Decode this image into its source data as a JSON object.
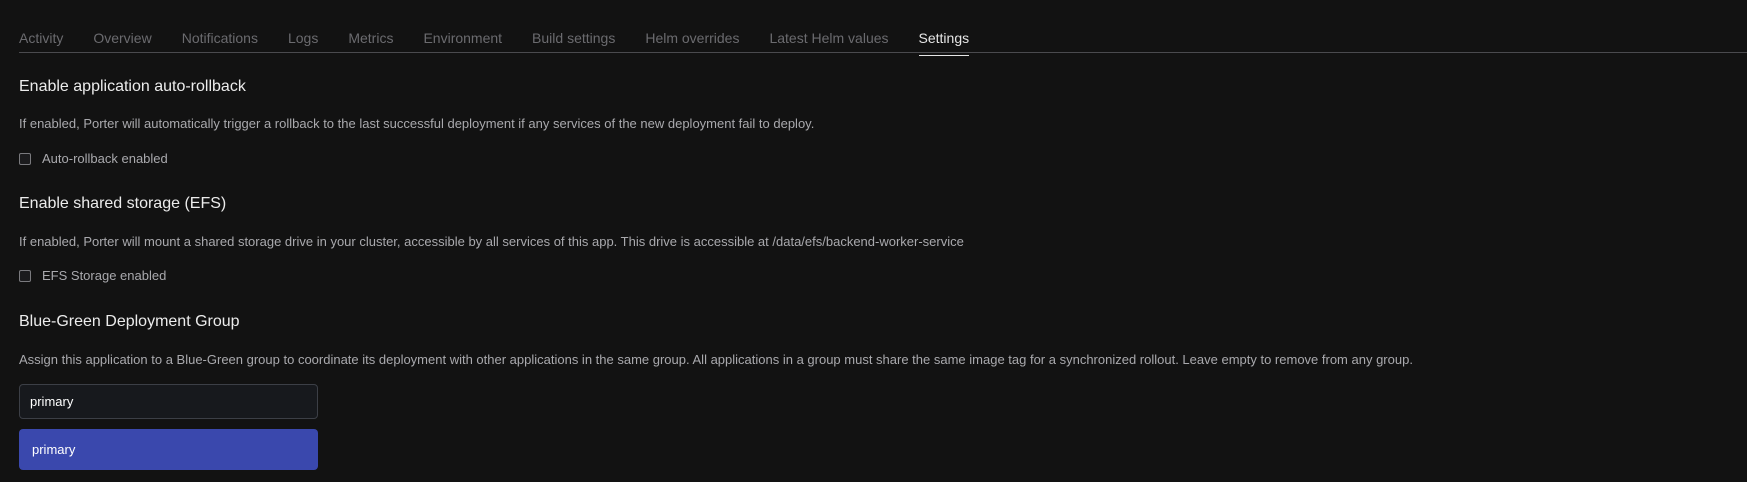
{
  "tabs": [
    {
      "label": "Activity"
    },
    {
      "label": "Overview"
    },
    {
      "label": "Notifications"
    },
    {
      "label": "Logs"
    },
    {
      "label": "Metrics"
    },
    {
      "label": "Environment"
    },
    {
      "label": "Build settings"
    },
    {
      "label": "Helm overrides"
    },
    {
      "label": "Latest Helm values"
    },
    {
      "label": "Settings",
      "active": true
    }
  ],
  "autorollback": {
    "title": "Enable application auto-rollback",
    "description": "If enabled, Porter will automatically trigger a rollback to the last successful deployment if any services of the new deployment fail to deploy.",
    "checkbox_label": "Auto-rollback enabled",
    "checked": false
  },
  "efs": {
    "title": "Enable shared storage (EFS)",
    "description": "If enabled, Porter will mount a shared storage drive in your cluster, accessible by all services of this app. This drive is accessible at /data/efs/backend-worker-service",
    "checkbox_label": "EFS Storage enabled",
    "checked": false
  },
  "bluegreen": {
    "title": "Blue-Green Deployment Group",
    "description": "Assign this application to a Blue-Green group to coordinate its deployment with other applications in the same group. All applications in a group must share the same image tag for a synchronized rollout. Leave empty to remove from any group.",
    "input_value": "primary",
    "options": [
      {
        "label": "primary",
        "highlighted": true
      }
    ]
  },
  "colors": {
    "background": "#121212",
    "accent": "#3a48ad"
  }
}
